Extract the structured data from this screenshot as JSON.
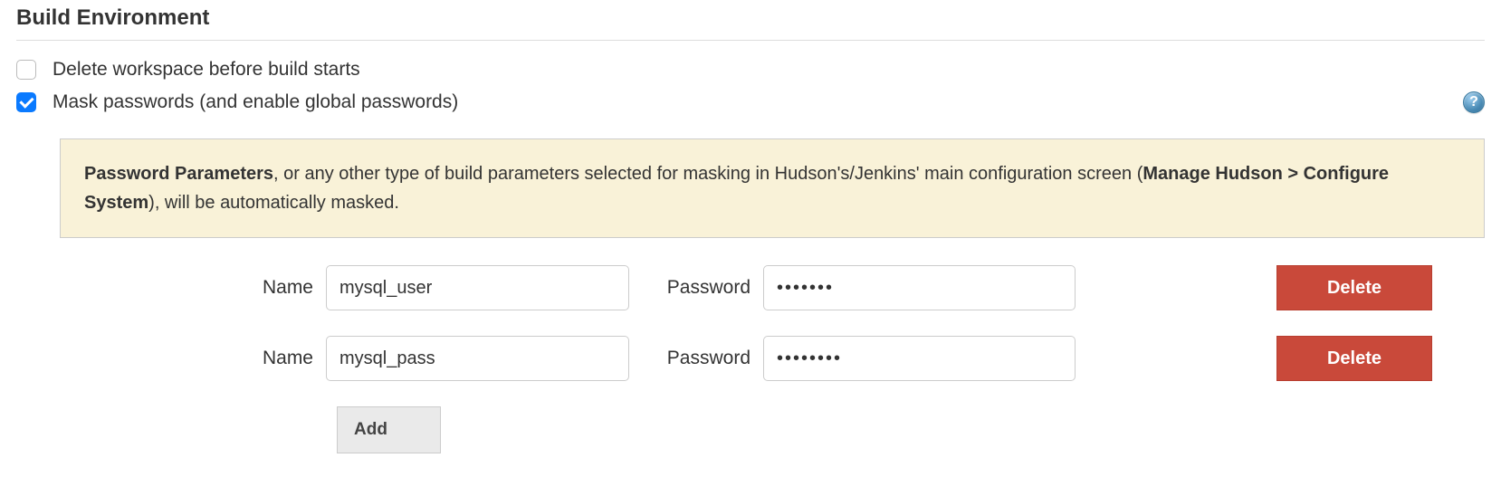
{
  "section": {
    "title": "Build Environment"
  },
  "options": {
    "delete_workspace": {
      "label": "Delete workspace before build starts",
      "checked": false
    },
    "mask_passwords": {
      "label": "Mask passwords (and enable global passwords)",
      "checked": true
    }
  },
  "info": {
    "bold1": "Password Parameters",
    "text1": ", or any other type of build parameters selected for masking in Hudson's/Jenkins' main configuration screen (",
    "bold2": "Manage Hudson > Configure System",
    "text2": "), will be automatically masked."
  },
  "labels": {
    "name": "Name",
    "password": "Password",
    "delete": "Delete",
    "add": "Add"
  },
  "params": [
    {
      "name": "mysql_user",
      "password": "•••••••"
    },
    {
      "name": "mysql_pass",
      "password": "••••••••"
    }
  ],
  "help_glyph": "?"
}
